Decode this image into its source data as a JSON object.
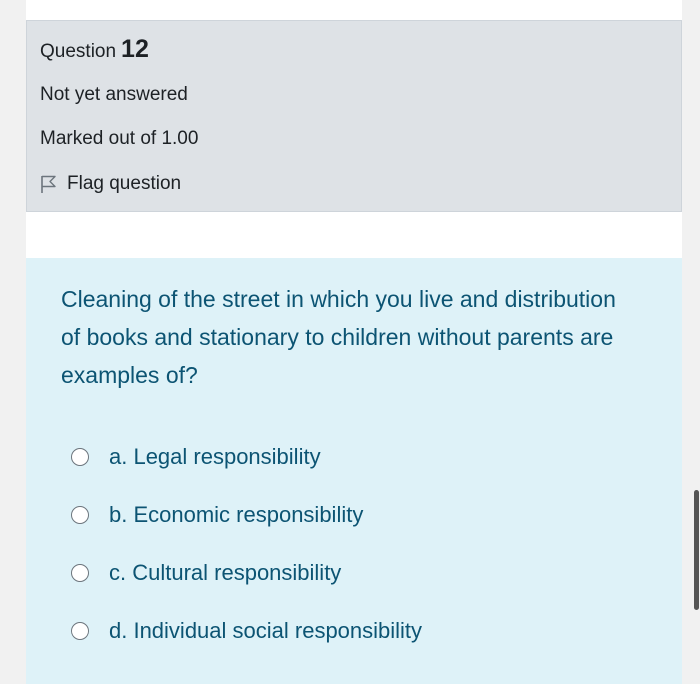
{
  "question": {
    "label": "Question",
    "number": "12",
    "state": "Not yet answered",
    "grade": "Marked out of 1.00",
    "flag_label": "Flag question"
  },
  "content": {
    "text": "Cleaning of the street in which you live and distribution of books and stationary to children without parents are examples of?",
    "options": [
      {
        "label": "a. Legal responsibility"
      },
      {
        "label": "b. Economic responsibility"
      },
      {
        "label": "c. Cultural responsibility"
      },
      {
        "label": "d. Individual social responsibility"
      }
    ]
  },
  "icons": {
    "flag": "flag-outline-icon",
    "radio": "radio-unchecked-icon"
  },
  "colors": {
    "info_bg": "#dee2e6",
    "content_bg": "#def2f8",
    "question_text": "#0c5473"
  }
}
